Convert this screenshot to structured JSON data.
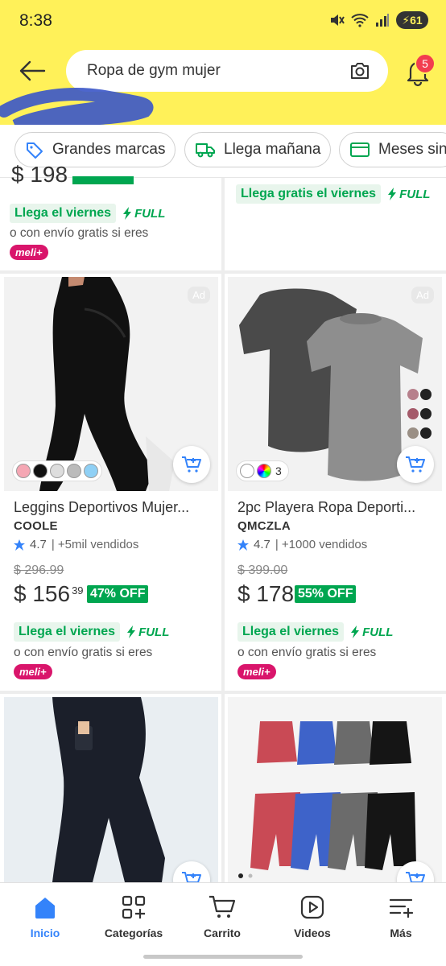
{
  "status_bar": {
    "time": "8:38",
    "battery": "61"
  },
  "header": {
    "search_text": "Ropa de gym mujer",
    "notification_count": "5",
    "accent_color": "#fff159"
  },
  "chips": [
    {
      "label": "Grandes marcas",
      "icon": "tag-icon"
    },
    {
      "label": "Llega mañana",
      "icon": "truck-icon"
    },
    {
      "label": "Meses sin",
      "icon": "credit-card-icon"
    }
  ],
  "partial_top": {
    "left": {
      "price": "$ 198",
      "shipping": "Llega el viernes",
      "full": "FULL",
      "alt_shipping": "o con envío gratis si eres",
      "meli": "meli+"
    },
    "right": {
      "shipping": "Llega gratis el viernes",
      "full": "FULL"
    }
  },
  "products": [
    {
      "ad": "Ad",
      "title": "Leggins Deportivos Mujer...",
      "brand": "COOLE",
      "rating": "4.7",
      "sold": "| +5mil vendidos",
      "old_price": "$ 296.99",
      "price": "$ 156",
      "cents": "39",
      "off": "47% OFF",
      "shipping": "Llega el viernes",
      "full": "FULL",
      "alt_shipping": "o con envío gratis si eres",
      "meli": "meli+"
    },
    {
      "ad": "Ad",
      "title": "2pc Playera Ropa Deporti...",
      "brand": "QMCZLA",
      "rating": "4.7",
      "sold": "| +1000 vendidos",
      "old_price": "$ 399.00",
      "price": "$ 178",
      "cents": "",
      "off": "55% OFF",
      "swatch_count": "3",
      "shipping": "Llega el viernes",
      "full": "FULL",
      "alt_shipping": "o con envío gratis si eres",
      "meli": "meli+"
    }
  ],
  "nav": [
    {
      "label": "Inicio",
      "icon": "home-icon",
      "active": true
    },
    {
      "label": "Categorías",
      "icon": "categories-icon"
    },
    {
      "label": "Carrito",
      "icon": "cart-icon"
    },
    {
      "label": "Videos",
      "icon": "play-icon"
    },
    {
      "label": "Más",
      "icon": "menu-plus-icon"
    }
  ]
}
